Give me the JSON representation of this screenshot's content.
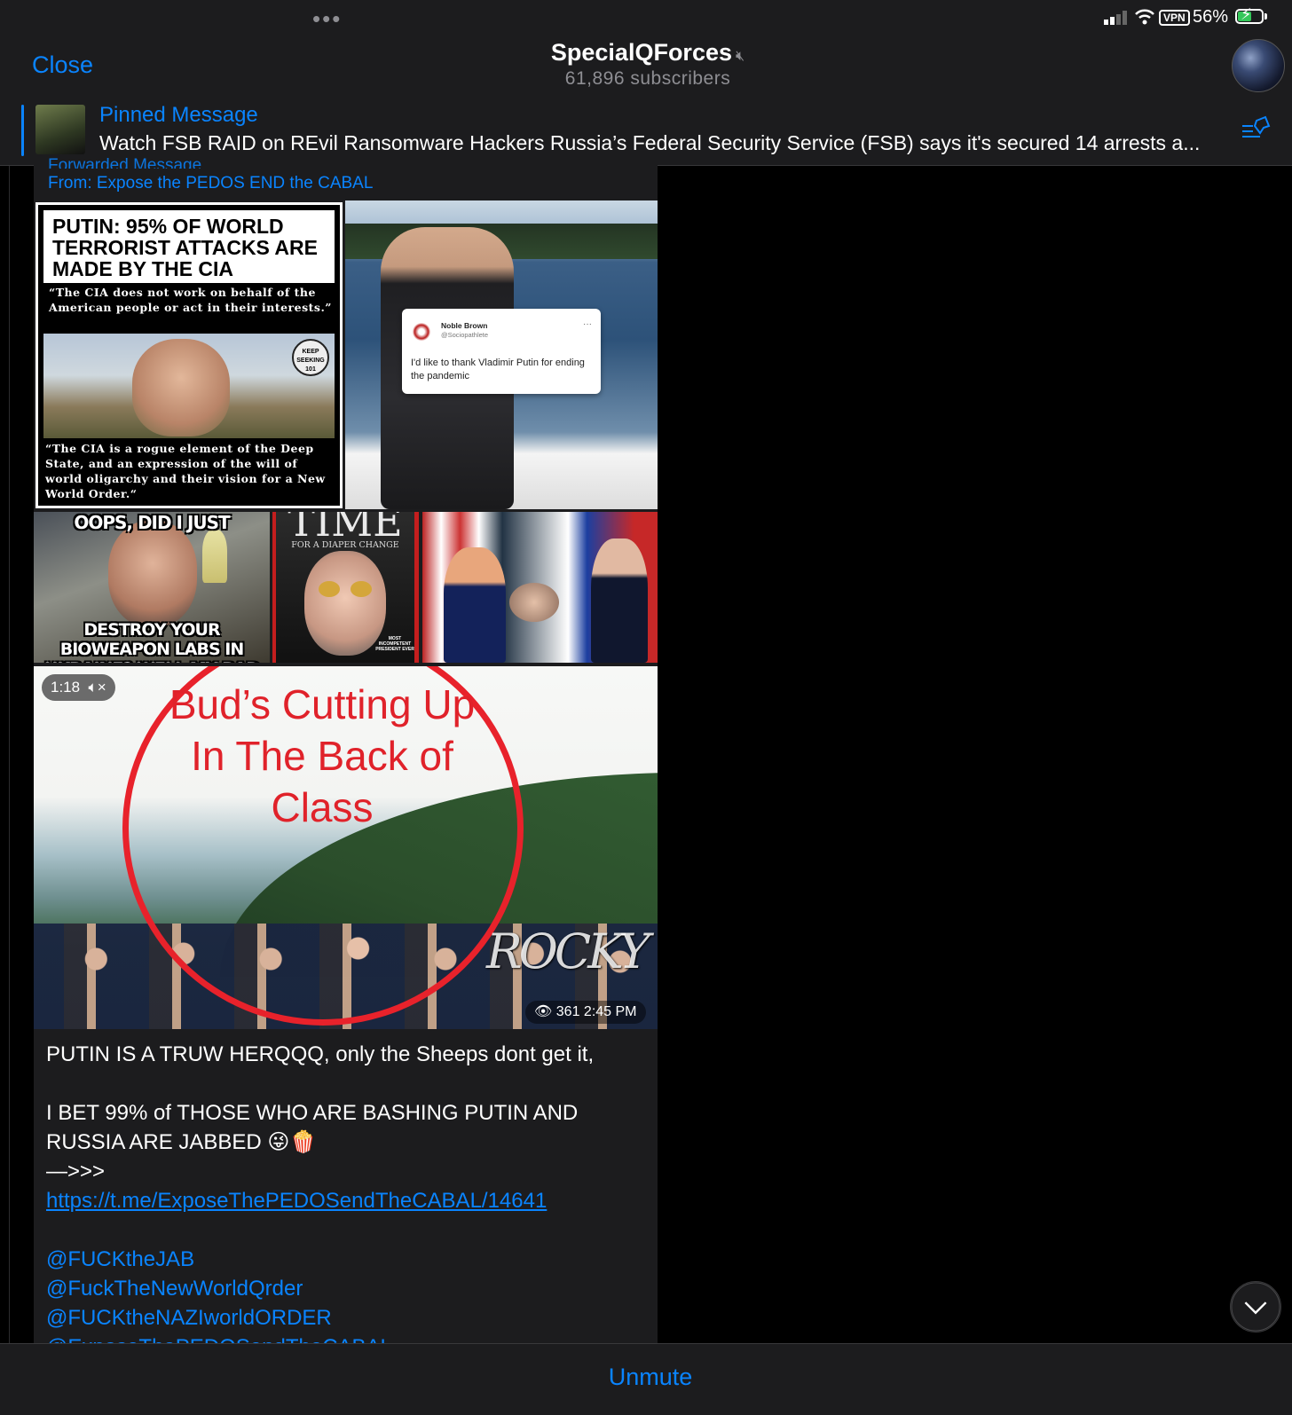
{
  "status_bar": {
    "battery_pct": "56%",
    "vpn": "VPN",
    "dots": "•••"
  },
  "header": {
    "close_label": "Close",
    "title": "SpecialQForces",
    "subscribers": "61,896 subscribers"
  },
  "pinned": {
    "label": "Pinned Message",
    "text": "Watch FSB RAID on REvil Ransomware Hackers Russia’s Federal Security Service (FSB) says it's secured 14 arrests a..."
  },
  "message": {
    "forwarded_label": "Forwarded Message",
    "forwarded_from": "From: Expose the PEDOS END the CABAL",
    "img1": {
      "headline": "PUTIN: 95% OF WORLD TERRORIST ATTACKS ARE MADE BY THE CIA",
      "quote1": "“The CIA does not work on behalf of the American people or act in their interests.”",
      "badge": "KEEP SEEKING 101",
      "quote2": "“The CIA is a rogue element of the Deep State, and an expression of the will of world oligarchy and their vision for a New World Order.“"
    },
    "img2": {
      "tweet_name": "Noble Brown",
      "tweet_handle": "@Sociopathlete",
      "tweet_text": "I'd like to thank Vladimir Putin for ending the pandemic",
      "tweet_more": "···"
    },
    "img3": {
      "top_text": "OOPS, DID I JUST",
      "bottom_text": "DESTROY YOUR BIOWEAPON LABS IN UKRAINE? WELL MY BAD"
    },
    "img4": {
      "masthead": "TIME",
      "subtitle": "FOR A DIAPER CHANGE",
      "tag": "MOST INCOMPETENT PRESIDENT EVER"
    },
    "video": {
      "duration": "1:18",
      "text": "Bud’s Cutting Up In The Back of Class",
      "watermark": "ROCKY",
      "views": "361",
      "time": "2:45 PM"
    },
    "caption": {
      "line1": "PUTIN IS A TRUW HERQQQ, only the Sheeps dont get it,",
      "line2": "I BET 99% of THOSE WHO ARE BASHING PUTIN AND RUSSIA ARE JABBED 😜🍿",
      "line3": "—>>>",
      "link": "https://t.me/ExposeThePEDOSendTheCABAL/14641",
      "mentions": [
        "@FUCKtheJAB",
        "@FuckTheNewWorldQrder",
        "@FUCKtheNAZIworldORDER",
        "@ExposeThePEDOSendTheCABAL"
      ]
    }
  },
  "bottom": {
    "unmute_label": "Unmute"
  }
}
